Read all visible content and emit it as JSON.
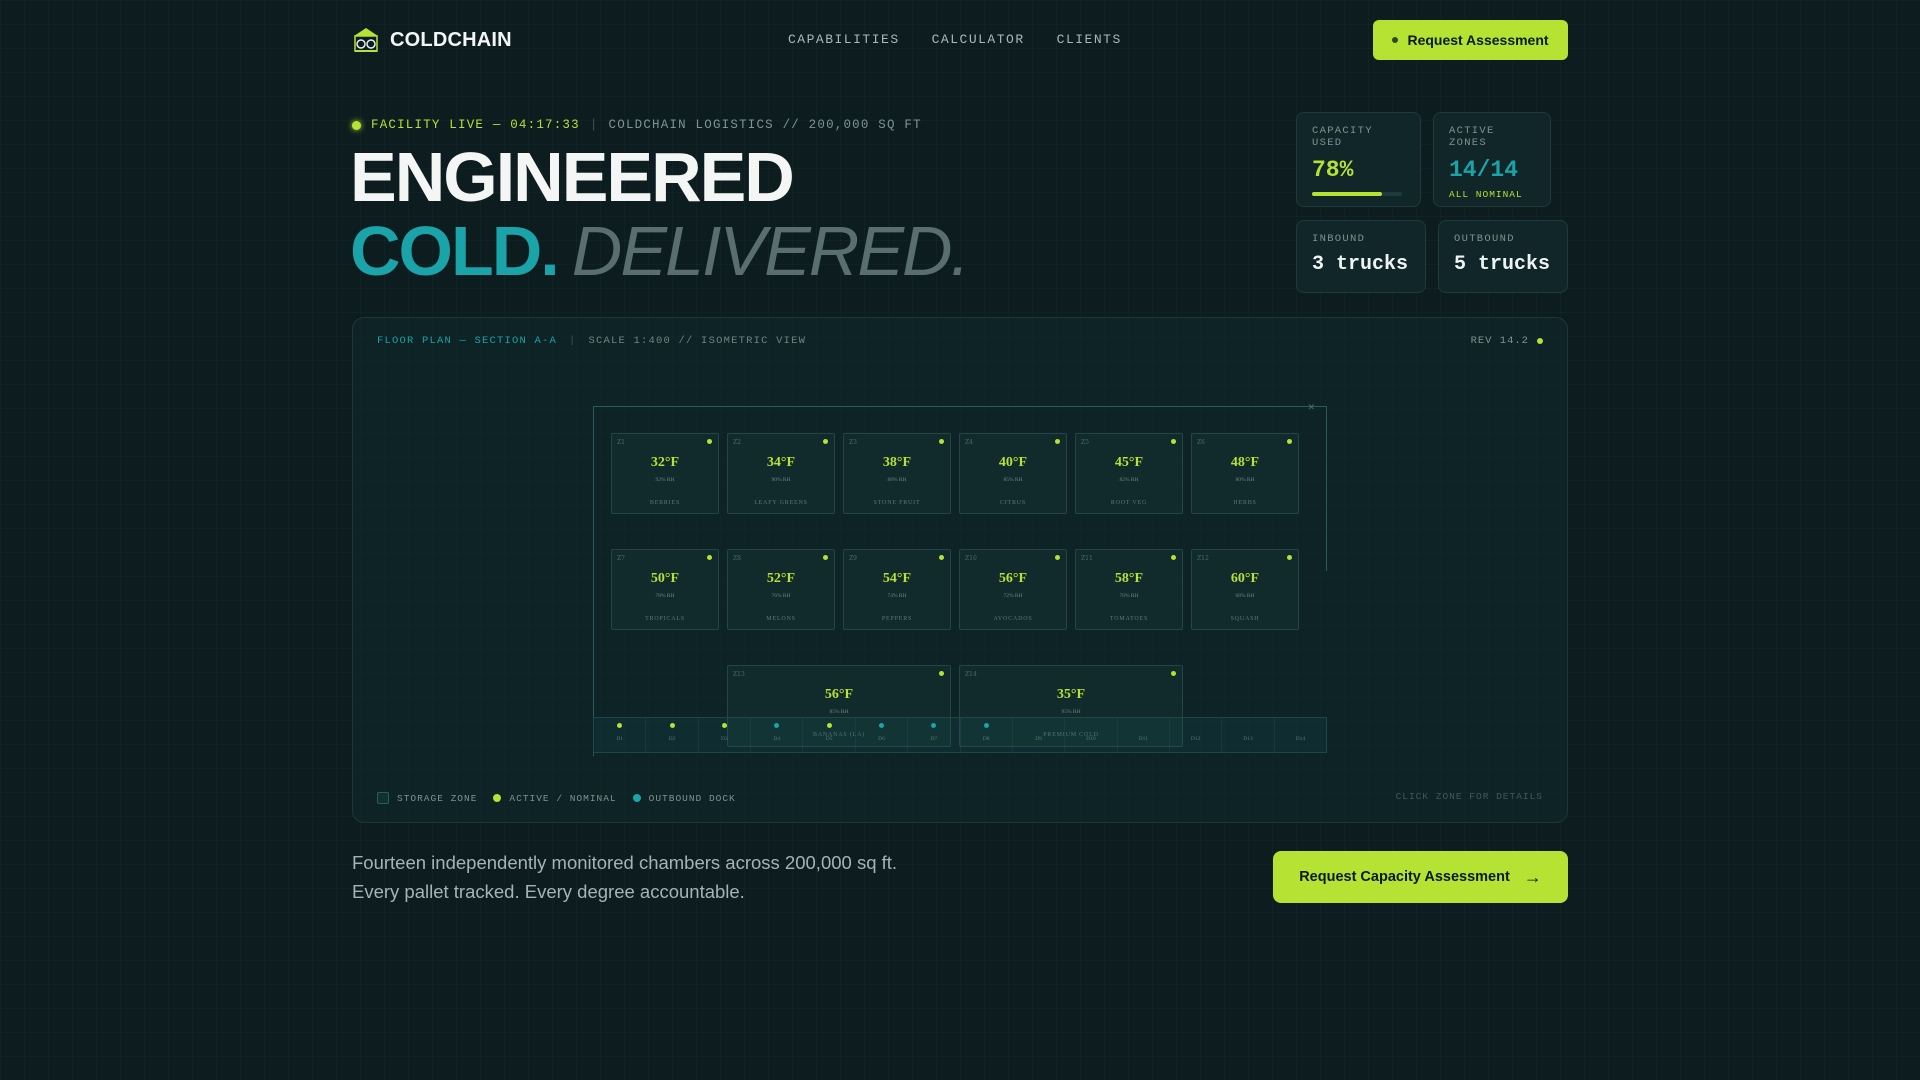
{
  "nav": {
    "brand": "COLDCHAIN",
    "links": [
      "CAPABILITIES",
      "CALCULATOR",
      "CLIENTS"
    ],
    "cta": "Request Assessment"
  },
  "hero": {
    "live": "FACILITY LIVE — 04:17:33",
    "facility": "COLDCHAIN LOGISTICS // 200,000 SQ FT",
    "line1": "ENGINEERED",
    "cold": "COLD.",
    "delivered": "DELIVERED."
  },
  "stats": {
    "capacity": {
      "label": "CAPACITY USED",
      "value": "78%",
      "fraction": 0.78
    },
    "zones": {
      "label": "ACTIVE ZONES",
      "value": "14/14",
      "sub": "ALL NOMINAL"
    },
    "inbound": {
      "label": "INBOUND",
      "value": "3 trucks"
    },
    "outbound": {
      "label": "OUTBOUND",
      "value": "5 trucks"
    }
  },
  "floor_plan": {
    "title": "FLOOR PLAN — SECTION A-A",
    "scale": "SCALE 1:400 // ISOMETRIC VIEW",
    "rev": "REV 14.2",
    "zones": [
      {
        "id": "Z1",
        "temp": "32°F",
        "rh": "92% RH",
        "name": "BERRIES"
      },
      {
        "id": "Z2",
        "temp": "34°F",
        "rh": "90% RH",
        "name": "LEAFY GREENS"
      },
      {
        "id": "Z3",
        "temp": "38°F",
        "rh": "88% RH",
        "name": "STONE FRUIT"
      },
      {
        "id": "Z4",
        "temp": "40°F",
        "rh": "85% RH",
        "name": "CITRUS"
      },
      {
        "id": "Z5",
        "temp": "45°F",
        "rh": "82% RH",
        "name": "ROOT VEG"
      },
      {
        "id": "Z6",
        "temp": "48°F",
        "rh": "80% RH",
        "name": "HERBS"
      },
      {
        "id": "Z7",
        "temp": "50°F",
        "rh": "78% RH",
        "name": "TROPICALS"
      },
      {
        "id": "Z8",
        "temp": "52°F",
        "rh": "76% RH",
        "name": "MELONS"
      },
      {
        "id": "Z9",
        "temp": "54°F",
        "rh": "74% RH",
        "name": "PEPPERS"
      },
      {
        "id": "Z10",
        "temp": "56°F",
        "rh": "72% RH",
        "name": "AVOCADOS"
      },
      {
        "id": "Z11",
        "temp": "58°F",
        "rh": "70% RH",
        "name": "TOMATOES"
      },
      {
        "id": "Z12",
        "temp": "60°F",
        "rh": "68% RH",
        "name": "SQUASH"
      },
      {
        "id": "Z13",
        "temp": "56°F",
        "rh": "85% RH",
        "name": "BANANAS (LA)"
      },
      {
        "id": "Z14",
        "temp": "35°F",
        "rh": "95% RH",
        "name": "PREMIUM COLD"
      }
    ],
    "docks": [
      "D1",
      "D2",
      "D3",
      "D4",
      "D5",
      "D6",
      "D7",
      "D8",
      "D9",
      "D10",
      "D11",
      "D12",
      "D13",
      "D14"
    ],
    "legend": {
      "storage": "STORAGE ZONE",
      "active": "ACTIVE / NOMINAL",
      "outbound": "OUTBOUND DOCK",
      "hint": "CLICK ZONE FOR DETAILS"
    }
  },
  "footer": {
    "line1": "Fourteen independently monitored chambers across 200,000 sq ft.",
    "line2": "Every pallet tracked. Every degree accountable.",
    "cta": "Request Capacity Assessment"
  },
  "colors": {
    "accent": "#b5e233",
    "teal": "#1aa3a9",
    "bg": "#0d1d1f"
  }
}
